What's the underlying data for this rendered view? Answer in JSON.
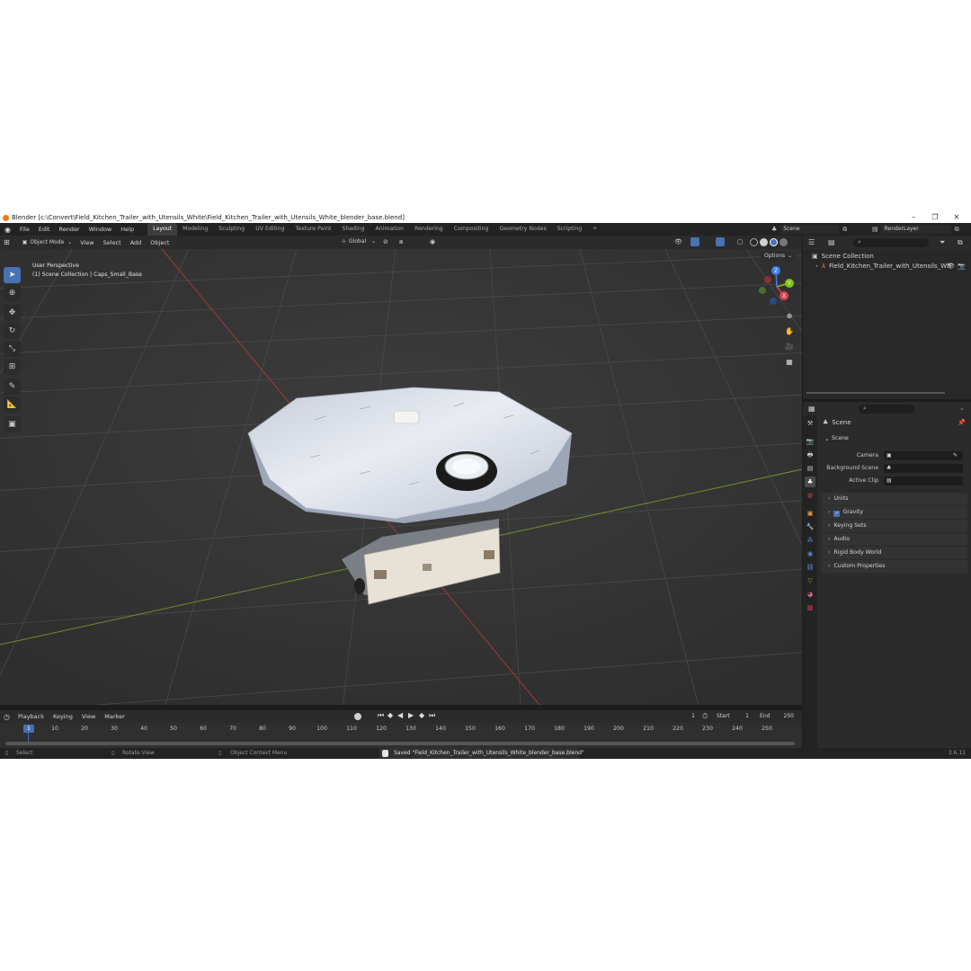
{
  "window": {
    "title": "Blender [c:\\Convert\\Field_Kitchen_Trailer_with_Utensils_White\\Field_Kitchen_Trailer_with_Utensils_White_blender_base.blend]"
  },
  "menu": [
    "File",
    "Edit",
    "Render",
    "Window",
    "Help"
  ],
  "workspaces": [
    "Layout",
    "Modeling",
    "Sculpting",
    "UV Editing",
    "Texture Paint",
    "Shading",
    "Animation",
    "Rendering",
    "Compositing",
    "Geometry Nodes",
    "Scripting"
  ],
  "scene_selector": "Scene",
  "view_layer": "RenderLayer",
  "viewport": {
    "mode": "Object Mode",
    "menus": [
      "View",
      "Select",
      "Add",
      "Object"
    ],
    "transform_orientation": "Global",
    "options_label": "Options",
    "perspective": "User Perspective",
    "collection_info": "(1) Scene Collection | Caps_Small_Base",
    "gizmo_axes": {
      "y": "Y",
      "x": "X",
      "z": "Z"
    }
  },
  "timeline": {
    "menus": [
      "Playback",
      "Keying",
      "View",
      "Marker"
    ],
    "current_frame": "1",
    "start_label": "Start",
    "start": "1",
    "end_label": "End",
    "end": "250",
    "frame_labels": [
      "1",
      "10",
      "20",
      "30",
      "40",
      "50",
      "60",
      "70",
      "80",
      "90",
      "100",
      "110",
      "120",
      "130",
      "140",
      "150",
      "160",
      "170",
      "180",
      "190",
      "200",
      "210",
      "220",
      "230",
      "240",
      "250"
    ]
  },
  "outliner": {
    "root": "Scene Collection",
    "items": [
      "Field_Kitchen_Trailer_with_Utensils_Wh"
    ]
  },
  "properties": {
    "header": "Scene",
    "section": "Scene",
    "fields": [
      {
        "label": "Camera"
      },
      {
        "label": "Background Scene"
      },
      {
        "label": "Active Clip"
      }
    ],
    "panels": [
      "Units",
      "Gravity",
      "Keying Sets",
      "Audio",
      "Rigid Body World",
      "Custom Properties"
    ]
  },
  "statusbar": {
    "select": "Select",
    "rotate": "Rotate View",
    "context_menu": "Object Context Menu",
    "message": "Saved \"Field_Kitchen_Trailer_with_Utensils_White_blender_base.blend\"",
    "version": "3.6.11"
  },
  "colors": {
    "accent": "#4772b3",
    "x_axis": "#e0434b",
    "y_axis": "#7ec31a",
    "z_axis": "#3d7ff2",
    "background": "#393939"
  }
}
